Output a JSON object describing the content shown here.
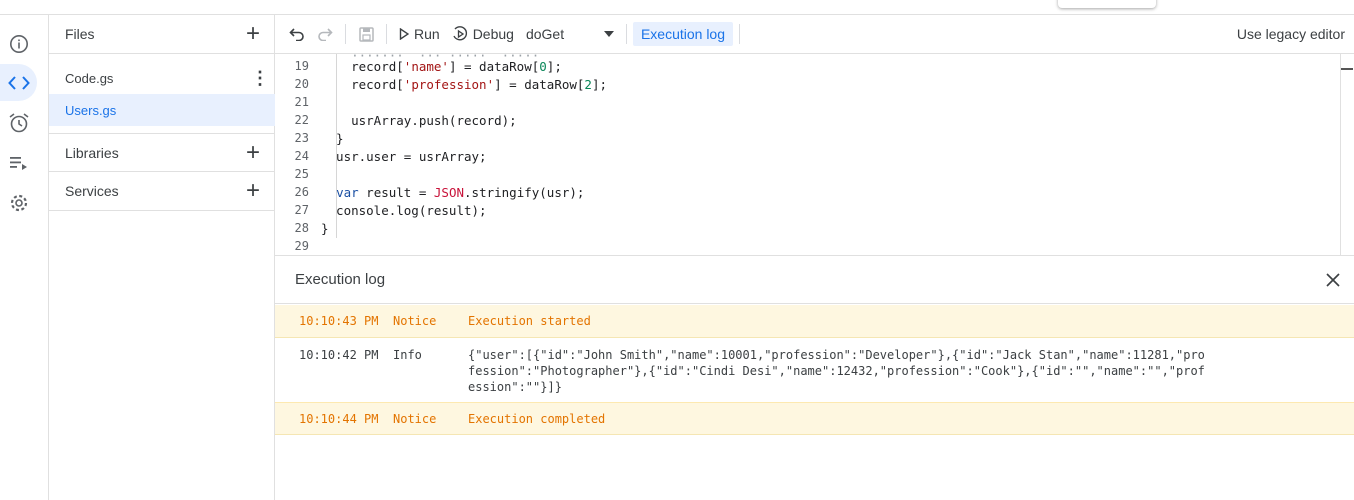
{
  "files_panel": {
    "title": "Files",
    "files": [
      {
        "name": "Code.gs"
      },
      {
        "name": "Users.gs"
      }
    ],
    "libraries_label": "Libraries",
    "services_label": "Services"
  },
  "toolbar": {
    "run_label": "Run",
    "debug_label": "Debug",
    "function_name": "doGet",
    "exec_log_label": "Execution log",
    "legacy_label": "Use legacy editor"
  },
  "editor": {
    "lines": [
      {
        "n": "19",
        "t": "    record['name'] = dataRow[0];"
      },
      {
        "n": "20",
        "t": "    record['profession'] = dataRow[2];"
      },
      {
        "n": "21",
        "t": ""
      },
      {
        "n": "22",
        "t": "    usrArray.push(record);"
      },
      {
        "n": "23",
        "t": "  }"
      },
      {
        "n": "24",
        "t": "  usr.user = usrArray;"
      },
      {
        "n": "25",
        "t": ""
      },
      {
        "n": "26",
        "t": "  var result = JSON.stringify(usr);"
      },
      {
        "n": "27",
        "t": "  console.log(result);"
      },
      {
        "n": "28",
        "t": "}"
      },
      {
        "n": "29",
        "t": ""
      }
    ]
  },
  "log_panel": {
    "title": "Execution log",
    "entries": [
      {
        "time": "10:10:43 PM",
        "level": "Notice",
        "message": "Execution started"
      },
      {
        "time": "10:10:42 PM",
        "level": "Info",
        "message": "{\"user\":[{\"id\":\"John Smith\",\"name\":10001,\"profession\":\"Developer\"},{\"id\":\"Jack Stan\",\"name\":11281,\"profession\":\"Photographer\"},{\"id\":\"Cindi Desi\",\"name\":12432,\"profession\":\"Cook\"},{\"id\":\"\",\"name\":\"\",\"profession\":\"\"}]}"
      },
      {
        "time": "10:10:44 PM",
        "level": "Notice",
        "message": "Execution completed"
      }
    ]
  },
  "colors": {
    "accent": "#1a73e8",
    "accent_bg": "#e8f0fe",
    "notice_bg": "#fef7e0",
    "notice_text": "#e37400"
  }
}
